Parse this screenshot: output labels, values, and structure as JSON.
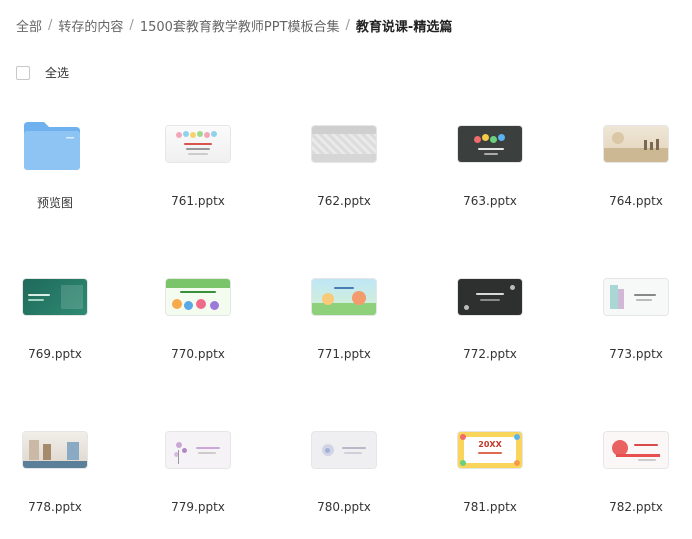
{
  "breadcrumb": {
    "items": [
      "全部",
      "转存的内容",
      "1500套教育教学教师PPT模板合集",
      "教育说课-精选篇"
    ],
    "separator": "/"
  },
  "select_all": {
    "label": "全选",
    "checked": false
  },
  "files": [
    {
      "name": "预览图",
      "type": "folder",
      "icon": "folder-icon"
    },
    {
      "name": "761.pptx",
      "type": "pptx",
      "theme": "white-bubbles"
    },
    {
      "name": "762.pptx",
      "type": "pptx",
      "theme": "grey-floral"
    },
    {
      "name": "763.pptx",
      "type": "pptx",
      "theme": "chalkboard-colorful"
    },
    {
      "name": "764.pptx",
      "type": "pptx",
      "theme": "sepia-scene"
    },
    {
      "name": "769.pptx",
      "type": "pptx",
      "theme": "teal-green"
    },
    {
      "name": "770.pptx",
      "type": "pptx",
      "theme": "traffic-safety-cartoon"
    },
    {
      "name": "771.pptx",
      "type": "pptx",
      "theme": "green-cartoon-kids"
    },
    {
      "name": "772.pptx",
      "type": "pptx",
      "theme": "chalkboard-dark"
    },
    {
      "name": "773.pptx",
      "type": "pptx",
      "theme": "watercolor-leaf"
    },
    {
      "name": "778.pptx",
      "type": "pptx",
      "theme": "classroom-photo"
    },
    {
      "name": "779.pptx",
      "type": "pptx",
      "theme": "purple-flowers"
    },
    {
      "name": "780.pptx",
      "type": "pptx",
      "theme": "light-grey-minimal"
    },
    {
      "name": "781.pptx",
      "type": "pptx",
      "theme": "yellow-kids-frame"
    },
    {
      "name": "782.pptx",
      "type": "pptx",
      "theme": "red-ribbon"
    }
  ],
  "thumb_text": {
    "781": "20XX"
  },
  "colors": {
    "folder": "#8dc4f3",
    "folder_tab": "#6fb1ee",
    "text": "#333333",
    "breadcrumb_current": "#222222"
  }
}
